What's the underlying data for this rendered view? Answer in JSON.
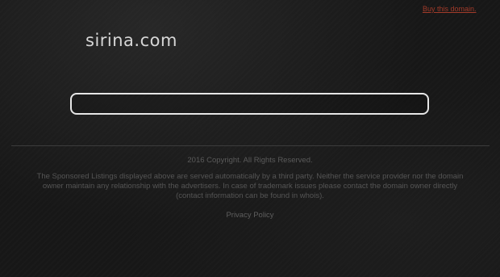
{
  "header": {
    "buy_link": "Buy this domain."
  },
  "site": {
    "title": "sirina.com"
  },
  "search": {
    "value": "",
    "placeholder": ""
  },
  "footer": {
    "copyright": "2016 Copyright. All Rights Reserved.",
    "disclaimer_line_1": "The Sponsored Listings displayed above are served automatically by a third party. Neither the service provider nor the domain",
    "disclaimer_line_2": "owner maintain any relationship with the advertisers. In case of trademark issues please contact the domain owner directly",
    "disclaimer_line_3": "(contact information can be found in whois).",
    "privacy_link": "Privacy Policy"
  },
  "colors": {
    "background": "#171717",
    "title": "#d6d6d6",
    "buy_link": "#a23b2a",
    "search_border": "#e6e6e6",
    "footer_text": "#5a5a5a"
  }
}
